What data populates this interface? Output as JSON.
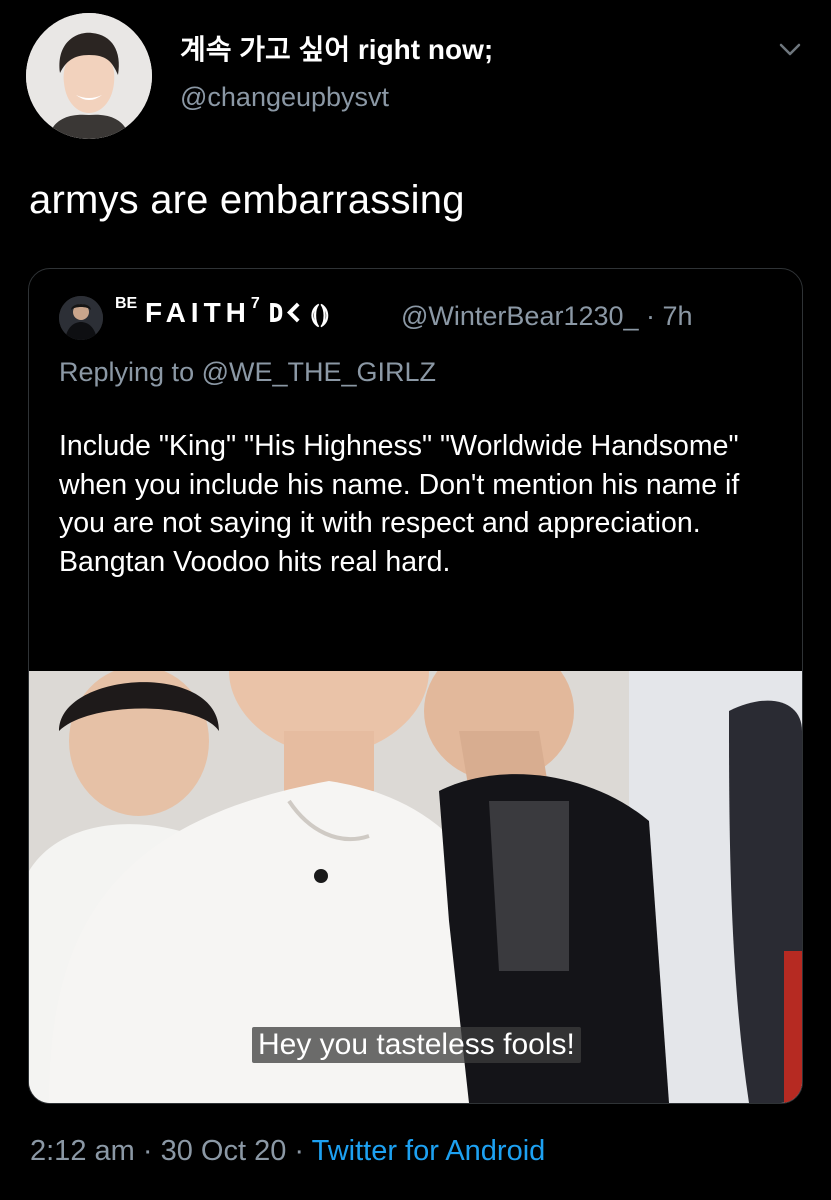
{
  "tweet": {
    "author": {
      "display_name": "계속 가고 싶어 right now;",
      "handle": "@changeupbysvt",
      "avatar_icon": "profile-photo"
    },
    "text": "armys are embarrassing",
    "menu_icon": "chevron-down-icon"
  },
  "quoted": {
    "name_prefix": "BE",
    "name_main": "FAITH",
    "name_sup": "7",
    "name_glyphs": "𐌃𐌂 ⦅⦆",
    "handle": "@WinterBear1230_",
    "time": "· 7h",
    "replying_to": "Replying to @WE_THE_GIRLZ",
    "body": "Include \"King\" \"His Highness\" \"Worldwide Handsome\" when you include his name. Don't mention his name if you are not saying it with respect and appreciation. Bangtan Voodoo hits real hard.",
    "media_caption": "Hey you tasteless fools!"
  },
  "footer": {
    "time": "2:12 am",
    "sep1": " · ",
    "date": "30 Oct 20",
    "sep2": " · ",
    "source": "Twitter for Android"
  },
  "colors": {
    "background": "#000000",
    "secondary_text": "#8b98a5",
    "link": "#1da1f2"
  }
}
